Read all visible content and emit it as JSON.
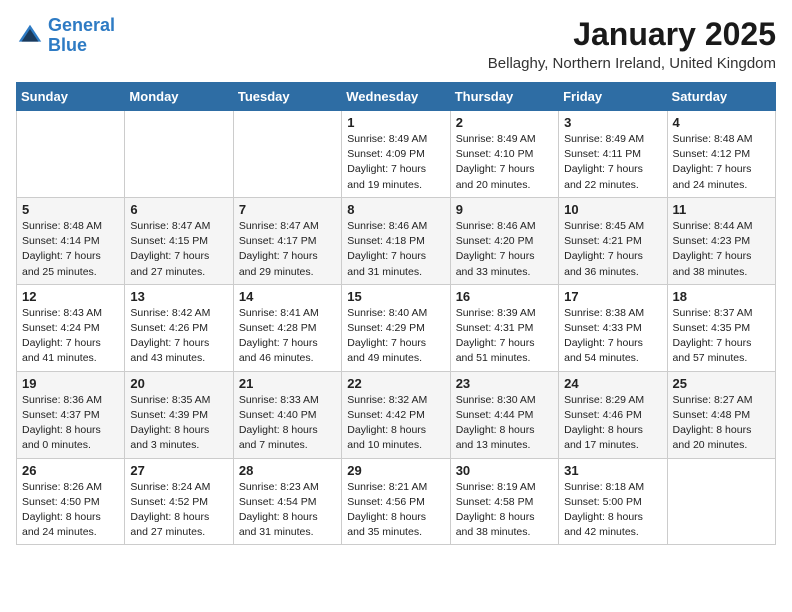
{
  "header": {
    "logo_line1": "General",
    "logo_line2": "Blue",
    "month_year": "January 2025",
    "location": "Bellaghy, Northern Ireland, United Kingdom"
  },
  "weekdays": [
    "Sunday",
    "Monday",
    "Tuesday",
    "Wednesday",
    "Thursday",
    "Friday",
    "Saturday"
  ],
  "weeks": [
    [
      {
        "day": "",
        "info": ""
      },
      {
        "day": "",
        "info": ""
      },
      {
        "day": "",
        "info": ""
      },
      {
        "day": "1",
        "info": "Sunrise: 8:49 AM\nSunset: 4:09 PM\nDaylight: 7 hours\nand 19 minutes."
      },
      {
        "day": "2",
        "info": "Sunrise: 8:49 AM\nSunset: 4:10 PM\nDaylight: 7 hours\nand 20 minutes."
      },
      {
        "day": "3",
        "info": "Sunrise: 8:49 AM\nSunset: 4:11 PM\nDaylight: 7 hours\nand 22 minutes."
      },
      {
        "day": "4",
        "info": "Sunrise: 8:48 AM\nSunset: 4:12 PM\nDaylight: 7 hours\nand 24 minutes."
      }
    ],
    [
      {
        "day": "5",
        "info": "Sunrise: 8:48 AM\nSunset: 4:14 PM\nDaylight: 7 hours\nand 25 minutes."
      },
      {
        "day": "6",
        "info": "Sunrise: 8:47 AM\nSunset: 4:15 PM\nDaylight: 7 hours\nand 27 minutes."
      },
      {
        "day": "7",
        "info": "Sunrise: 8:47 AM\nSunset: 4:17 PM\nDaylight: 7 hours\nand 29 minutes."
      },
      {
        "day": "8",
        "info": "Sunrise: 8:46 AM\nSunset: 4:18 PM\nDaylight: 7 hours\nand 31 minutes."
      },
      {
        "day": "9",
        "info": "Sunrise: 8:46 AM\nSunset: 4:20 PM\nDaylight: 7 hours\nand 33 minutes."
      },
      {
        "day": "10",
        "info": "Sunrise: 8:45 AM\nSunset: 4:21 PM\nDaylight: 7 hours\nand 36 minutes."
      },
      {
        "day": "11",
        "info": "Sunrise: 8:44 AM\nSunset: 4:23 PM\nDaylight: 7 hours\nand 38 minutes."
      }
    ],
    [
      {
        "day": "12",
        "info": "Sunrise: 8:43 AM\nSunset: 4:24 PM\nDaylight: 7 hours\nand 41 minutes."
      },
      {
        "day": "13",
        "info": "Sunrise: 8:42 AM\nSunset: 4:26 PM\nDaylight: 7 hours\nand 43 minutes."
      },
      {
        "day": "14",
        "info": "Sunrise: 8:41 AM\nSunset: 4:28 PM\nDaylight: 7 hours\nand 46 minutes."
      },
      {
        "day": "15",
        "info": "Sunrise: 8:40 AM\nSunset: 4:29 PM\nDaylight: 7 hours\nand 49 minutes."
      },
      {
        "day": "16",
        "info": "Sunrise: 8:39 AM\nSunset: 4:31 PM\nDaylight: 7 hours\nand 51 minutes."
      },
      {
        "day": "17",
        "info": "Sunrise: 8:38 AM\nSunset: 4:33 PM\nDaylight: 7 hours\nand 54 minutes."
      },
      {
        "day": "18",
        "info": "Sunrise: 8:37 AM\nSunset: 4:35 PM\nDaylight: 7 hours\nand 57 minutes."
      }
    ],
    [
      {
        "day": "19",
        "info": "Sunrise: 8:36 AM\nSunset: 4:37 PM\nDaylight: 8 hours\nand 0 minutes."
      },
      {
        "day": "20",
        "info": "Sunrise: 8:35 AM\nSunset: 4:39 PM\nDaylight: 8 hours\nand 3 minutes."
      },
      {
        "day": "21",
        "info": "Sunrise: 8:33 AM\nSunset: 4:40 PM\nDaylight: 8 hours\nand 7 minutes."
      },
      {
        "day": "22",
        "info": "Sunrise: 8:32 AM\nSunset: 4:42 PM\nDaylight: 8 hours\nand 10 minutes."
      },
      {
        "day": "23",
        "info": "Sunrise: 8:30 AM\nSunset: 4:44 PM\nDaylight: 8 hours\nand 13 minutes."
      },
      {
        "day": "24",
        "info": "Sunrise: 8:29 AM\nSunset: 4:46 PM\nDaylight: 8 hours\nand 17 minutes."
      },
      {
        "day": "25",
        "info": "Sunrise: 8:27 AM\nSunset: 4:48 PM\nDaylight: 8 hours\nand 20 minutes."
      }
    ],
    [
      {
        "day": "26",
        "info": "Sunrise: 8:26 AM\nSunset: 4:50 PM\nDaylight: 8 hours\nand 24 minutes."
      },
      {
        "day": "27",
        "info": "Sunrise: 8:24 AM\nSunset: 4:52 PM\nDaylight: 8 hours\nand 27 minutes."
      },
      {
        "day": "28",
        "info": "Sunrise: 8:23 AM\nSunset: 4:54 PM\nDaylight: 8 hours\nand 31 minutes."
      },
      {
        "day": "29",
        "info": "Sunrise: 8:21 AM\nSunset: 4:56 PM\nDaylight: 8 hours\nand 35 minutes."
      },
      {
        "day": "30",
        "info": "Sunrise: 8:19 AM\nSunset: 4:58 PM\nDaylight: 8 hours\nand 38 minutes."
      },
      {
        "day": "31",
        "info": "Sunrise: 8:18 AM\nSunset: 5:00 PM\nDaylight: 8 hours\nand 42 minutes."
      },
      {
        "day": "",
        "info": ""
      }
    ]
  ]
}
